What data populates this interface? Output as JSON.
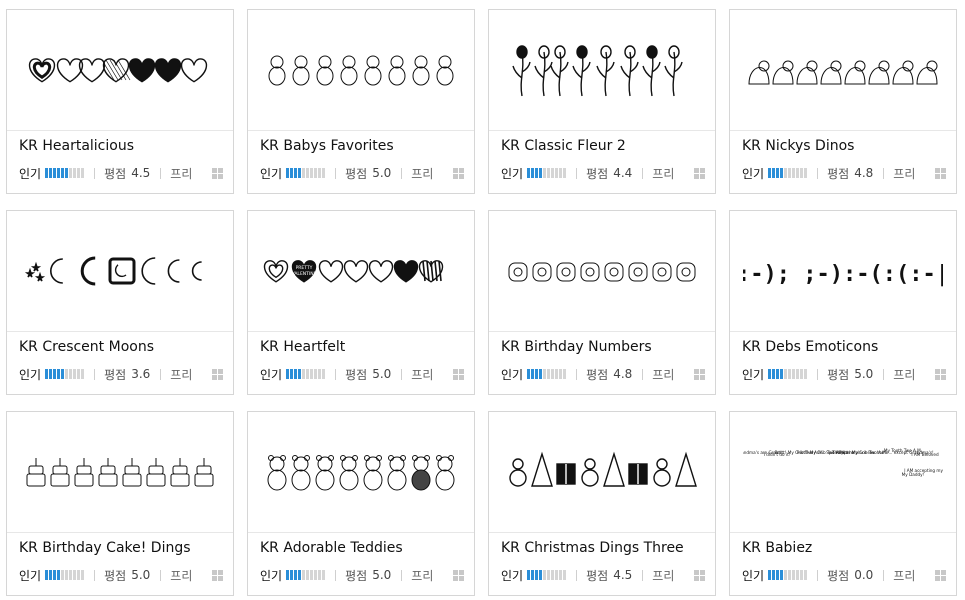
{
  "labels": {
    "popularity": "인기",
    "rating": "평점"
  },
  "icons": {
    "os": "windows-icon"
  },
  "colors": {
    "popularity_on": "#2a8ed8",
    "popularity_off": "#d5d5d5"
  },
  "fonts": [
    {
      "name": "KR Heartalicious",
      "popularity": 0.55,
      "rating": "4.5",
      "license": "프리",
      "preview": "hearts"
    },
    {
      "name": "KR Babys Favorites",
      "popularity": 0.4,
      "rating": "5.0",
      "license": "프리",
      "preview": "baby-toys"
    },
    {
      "name": "KR Classic Fleur 2",
      "popularity": 0.4,
      "rating": "4.4",
      "license": "프리",
      "preview": "flowers"
    },
    {
      "name": "KR Nickys Dinos",
      "popularity": 0.4,
      "rating": "4.8",
      "license": "프리",
      "preview": "dinos"
    },
    {
      "name": "KR Crescent Moons",
      "popularity": 0.45,
      "rating": "3.6",
      "license": "프리",
      "preview": "moons"
    },
    {
      "name": "KR Heartfelt",
      "popularity": 0.35,
      "rating": "5.0",
      "license": "프리",
      "preview": "hearts-2",
      "preview_text": [
        "PRETTY",
        "VALENTINE"
      ]
    },
    {
      "name": "KR Birthday Numbers",
      "popularity": 0.35,
      "rating": "4.8",
      "license": "프리",
      "preview": "numbers"
    },
    {
      "name": "KR Debs Emoticons",
      "popularity": 0.35,
      "rating": "5.0",
      "license": "프리",
      "preview": "emoticons",
      "preview_text": ":-); ;-):-(:(:-|"
    },
    {
      "name": "KR Birthday Cake! Dings",
      "popularity": 0.35,
      "rating": "5.0",
      "license": "프리",
      "preview": "cakes"
    },
    {
      "name": "KR Adorable Teddies",
      "popularity": 0.35,
      "rating": "5.0",
      "license": "프리",
      "preview": "teddies"
    },
    {
      "name": "KR Christmas Dings Three",
      "popularity": 0.35,
      "rating": "4.5",
      "license": "프리",
      "preview": "christmas"
    },
    {
      "name": "KR Babiez",
      "popularity": 0.35,
      "rating": "0.0",
      "license": "프리",
      "preview": "babiez-text",
      "preview_text": [
        "Grandma's are Great!",
        "I didn't do it!",
        "Pertt! My Crib Two A.M.",
        "Pertt! My Crib Two A.M.",
        "Spit Happens!",
        "Pertt! My Crib Two A.M.",
        "There's no place like home... except Grandma's!",
        "My Tooth Two A.M.",
        "I AM Beloved",
        "My Daddy!",
        "I AM accepting my age!"
      ]
    }
  ]
}
